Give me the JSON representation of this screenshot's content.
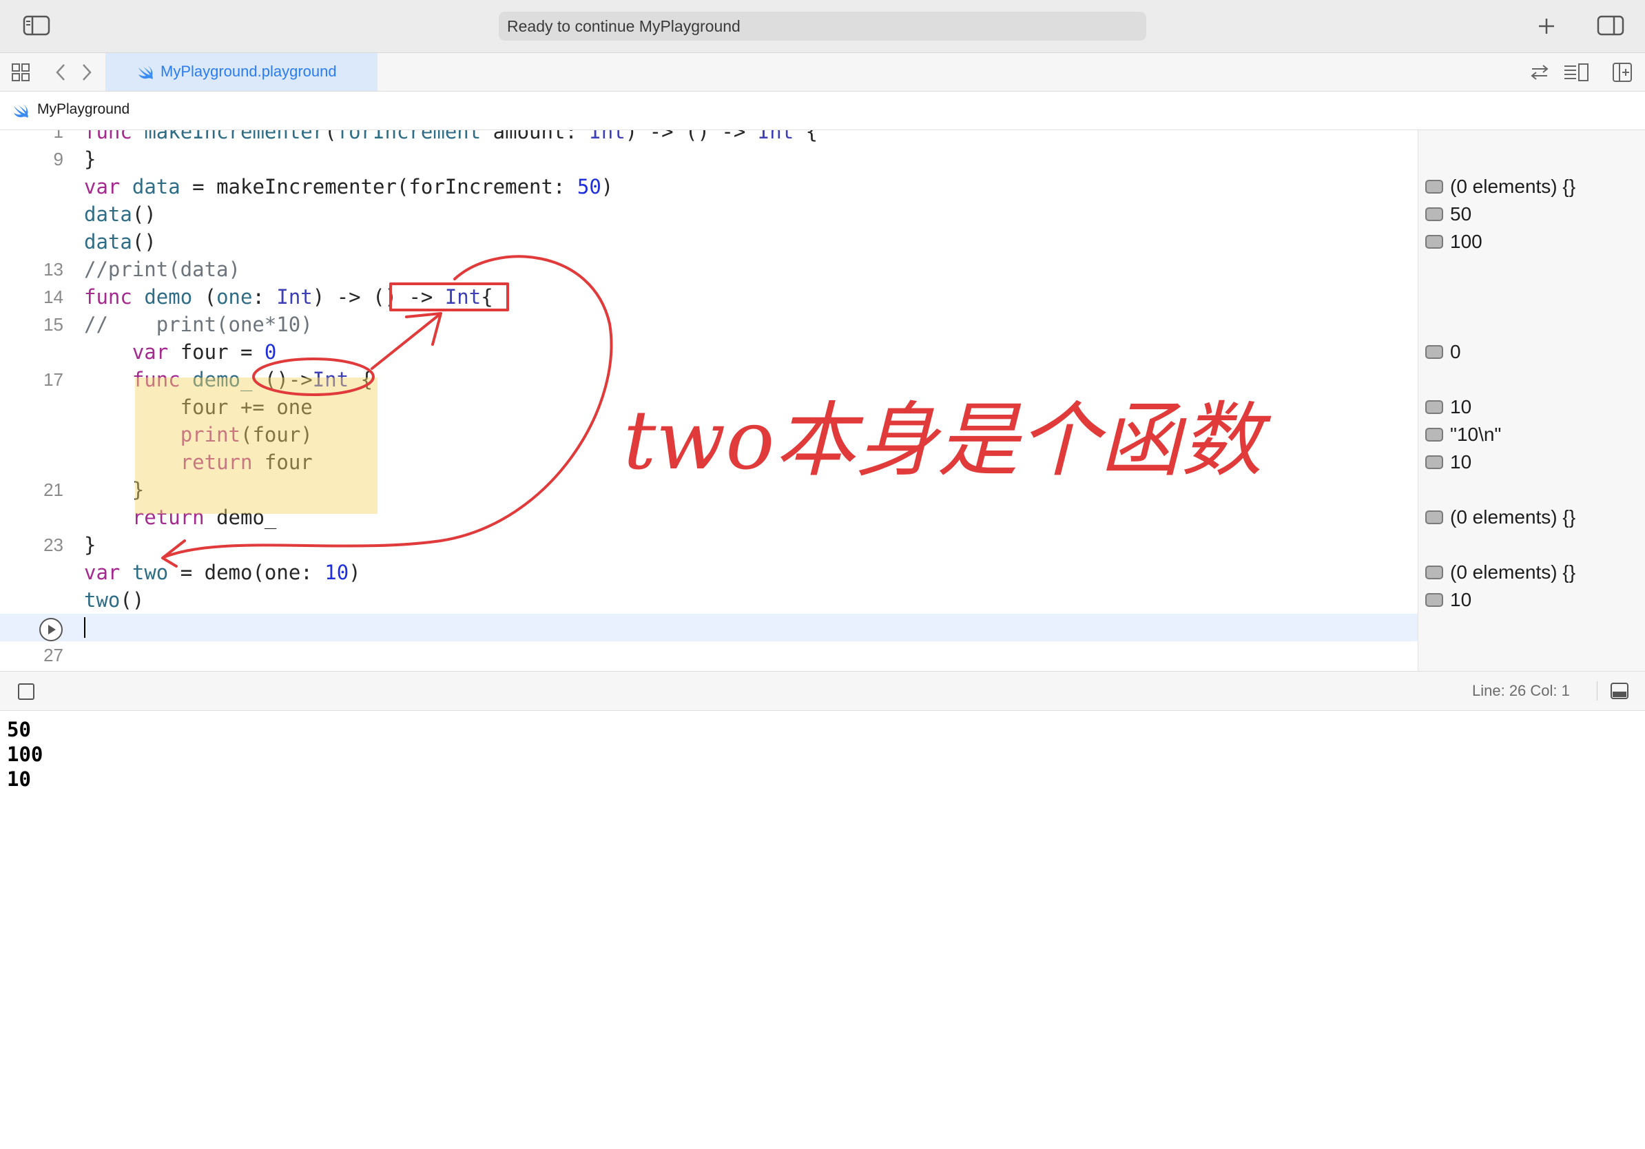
{
  "window": {
    "status": "Ready to continue MyPlayground"
  },
  "tab": {
    "label": "MyPlayground.playground"
  },
  "breadcrumb": {
    "label": "MyPlayground"
  },
  "editor": {
    "lines": [
      {
        "num": "1",
        "html": "<span class='kw'>func</span> <span class='fn'>makeIncrementer</span>(<span class='fn'>forIncrement</span> amount: <span class='ty'>Int</span>) -> () -> <span class='ty'>Int</span> {"
      },
      {
        "num": "9",
        "html": "}"
      },
      {
        "num": "",
        "html": "<span class='kw'>var</span> <span class='fn'>data</span> = makeIncrementer(forIncrement: <span class='num'>50</span>)"
      },
      {
        "num": "",
        "html": "<span class='fn'>data</span>()"
      },
      {
        "num": "",
        "html": "<span class='fn'>data</span>()"
      },
      {
        "num": "13",
        "html": "<span class='cm'>//print(data)</span>"
      },
      {
        "num": "14",
        "html": "<span class='kw'>func</span> <span class='fn'>demo</span> (<span class='fn'>one</span>: <span class='ty'>Int</span>) -> () -> <span class='ty'>Int</span>{"
      },
      {
        "num": "15",
        "html": "<span class='cm'>//    print(one*10)</span>"
      },
      {
        "num": "",
        "html": "    <span class='kw'>var</span> four = <span class='num'>0</span>"
      },
      {
        "num": "17",
        "html": "    <span class='kw'>func</span> <span class='fn'>demo_</span> ()-><span class='ty'>Int</span> {"
      },
      {
        "num": "",
        "html": "        four += one"
      },
      {
        "num": "",
        "html": "        <span class='kw'>print</span>(four)"
      },
      {
        "num": "",
        "html": "        <span class='kw'>return</span> four"
      },
      {
        "num": "21",
        "html": "    }"
      },
      {
        "num": "",
        "html": "    <span class='kw'>return</span> demo_"
      },
      {
        "num": "23",
        "html": "}"
      },
      {
        "num": "",
        "html": "<span class='kw'>var</span> <span class='fn'>two</span> = demo(one: <span class='num'>10</span>)"
      },
      {
        "num": "",
        "html": "<span class='fn'>two</span>()"
      },
      {
        "num": "",
        "html": ""
      },
      {
        "num": "27",
        "html": ""
      }
    ]
  },
  "results": [
    {
      "row": 2,
      "text": "(0 elements) {}"
    },
    {
      "row": 3,
      "text": "50"
    },
    {
      "row": 4,
      "text": "100"
    },
    {
      "row": 8,
      "text": "0"
    },
    {
      "row": 10,
      "text": "10"
    },
    {
      "row": 11,
      "text": "\"10\\n\""
    },
    {
      "row": 12,
      "text": "10"
    },
    {
      "row": 14,
      "text": "(0 elements) {}"
    },
    {
      "row": 16,
      "text": "(0 elements) {}"
    },
    {
      "row": 17,
      "text": "10"
    }
  ],
  "statusbar": {
    "position": "Line: 26  Col: 1"
  },
  "console": {
    "lines": [
      "50",
      "100",
      "10"
    ]
  },
  "annotation": {
    "text": "two本身是个函数",
    "color": "#e03a3a"
  }
}
